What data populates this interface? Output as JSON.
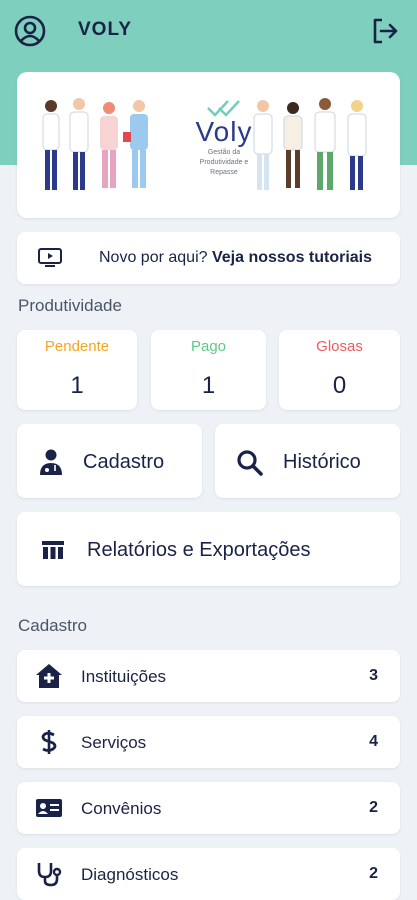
{
  "header": {
    "title": "VOLY",
    "profile_icon": "user-circle-icon",
    "logout_icon": "logout-icon"
  },
  "banner": {
    "brand_name": "Voly",
    "tagline": "Gestão da Produtividade e Repasse"
  },
  "tutorial": {
    "prefix": "Novo por aqui?",
    "link": "Veja nossos tutoriais"
  },
  "productivity": {
    "title": "Produtividade",
    "stats": [
      {
        "label": "Pendente",
        "value": "1",
        "color": "#f5a524"
      },
      {
        "label": "Pago",
        "value": "1",
        "color": "#5fc787"
      },
      {
        "label": "Glosas",
        "value": "0",
        "color": "#f05b5b"
      }
    ]
  },
  "actions": {
    "cadastro": "Cadastro",
    "historico": "Histórico",
    "relatorios": "Relatórios e Exportações"
  },
  "cadastro": {
    "title": "Cadastro",
    "items": [
      {
        "label": "Instituições",
        "count": "3",
        "icon": "hospital-icon"
      },
      {
        "label": "Serviços",
        "count": "4",
        "icon": "dollar-icon"
      },
      {
        "label": "Convênios",
        "count": "2",
        "icon": "id-card-icon"
      },
      {
        "label": "Diagnósticos",
        "count": "2",
        "icon": "stethoscope-icon"
      }
    ]
  },
  "colors": {
    "teal": "#7fcfbf",
    "navy": "#1a2347"
  }
}
